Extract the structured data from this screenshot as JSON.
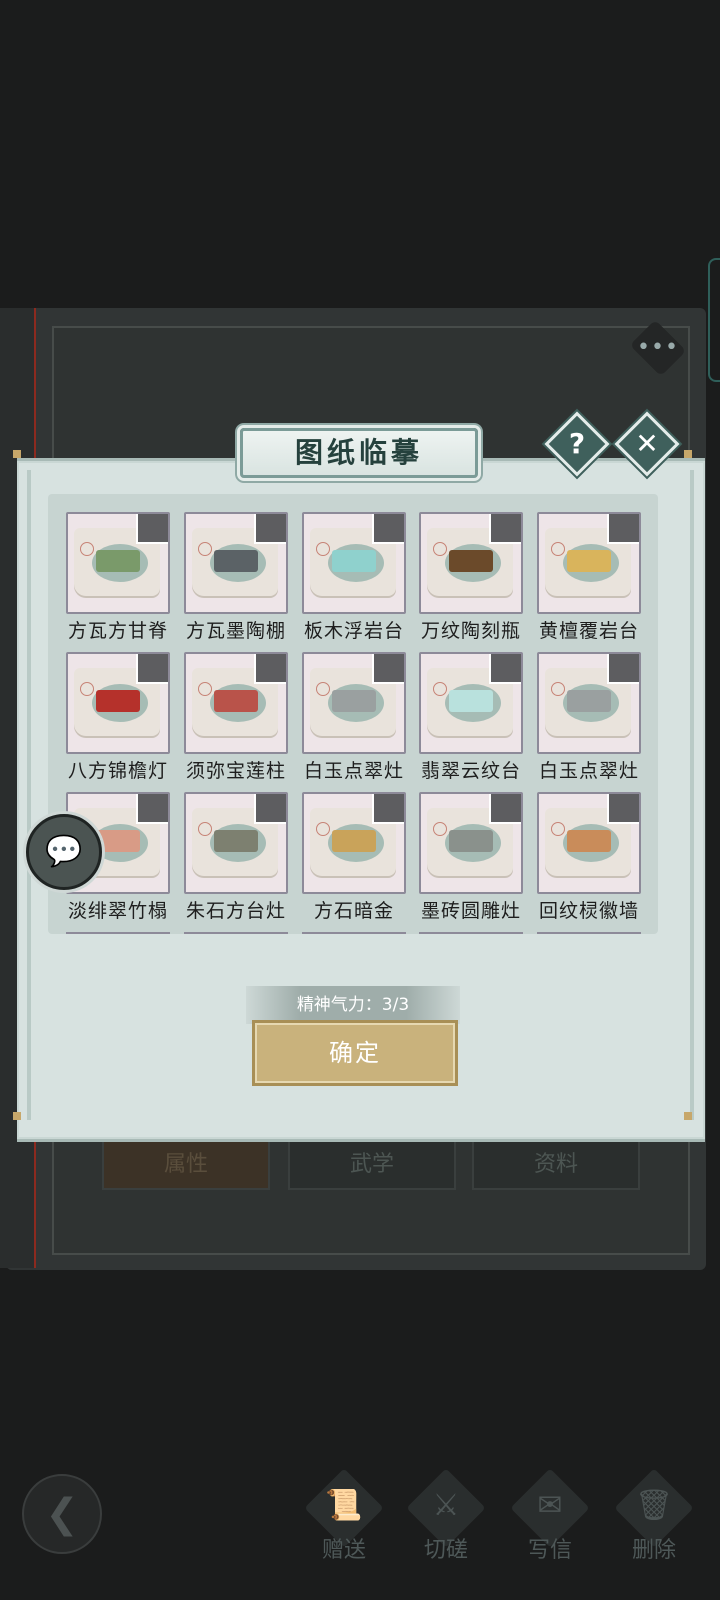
{
  "dialog": {
    "title": "图纸临摹",
    "help_icon": "?",
    "close_icon": "✕"
  },
  "grid": {
    "items": [
      {
        "label": "方瓦方甘脊",
        "icon": "beam-frame",
        "color": "#7a9a6a"
      },
      {
        "label": "方瓦墨陶棚",
        "icon": "pavilion-frame",
        "color": "#5b6266"
      },
      {
        "label": "板木浮岩台",
        "icon": "stone-slab",
        "color": "#8fd1cd"
      },
      {
        "label": "万纹陶刻瓶",
        "icon": "flower-vase",
        "color": "#6b4a2a"
      },
      {
        "label": "黄檀覆岩台",
        "icon": "wooden-platform",
        "color": "#d9b45c"
      },
      {
        "label": "八方锦檐灯",
        "icon": "hanging-lantern",
        "color": "#b5312b"
      },
      {
        "label": "须弥宝莲柱",
        "icon": "pillar",
        "color": "#b9534a"
      },
      {
        "label": "白玉点翠灶",
        "icon": "stove",
        "color": "#9aa0a0"
      },
      {
        "label": "翡翠云纹台",
        "icon": "jade-slab",
        "color": "#b9e1dd"
      },
      {
        "label": "白玉点翠灶",
        "icon": "stove",
        "color": "#9aa0a0"
      },
      {
        "label": "淡绯翠竹榻",
        "icon": "bamboo-bed",
        "color": "#d89b86"
      },
      {
        "label": "朱石方台灶",
        "icon": "chimney-stove",
        "color": "#7d8070"
      },
      {
        "label": "方石暗金",
        "icon": "gold-tile",
        "color": "#c9a35a"
      },
      {
        "label": "墨砖圆雕灶",
        "icon": "stove",
        "color": "#8a918c"
      },
      {
        "label": "回纹棂徽墙",
        "icon": "lattice-wall",
        "color": "#c98c5a"
      }
    ]
  },
  "energy": {
    "text": "精神气力：3/3"
  },
  "confirm": {
    "label": "确定"
  },
  "background_tabs": [
    "属性",
    "武学",
    "资料"
  ],
  "bottom_bar": {
    "back_icon": "❮",
    "actions": [
      {
        "label": "赠送",
        "icon": "scroll-icon",
        "glyph": "📜"
      },
      {
        "label": "切磋",
        "icon": "sword-icon",
        "glyph": "⚔"
      },
      {
        "label": "写信",
        "icon": "letter-icon",
        "glyph": "✉"
      },
      {
        "label": "删除",
        "icon": "trash-icon",
        "glyph": "🗑"
      }
    ]
  },
  "colors": {
    "modal_bg": "#d7e2e0",
    "title_color": "#25413d",
    "confirm_bg": "#c9b27c",
    "accent_dark": "#3f605c"
  }
}
